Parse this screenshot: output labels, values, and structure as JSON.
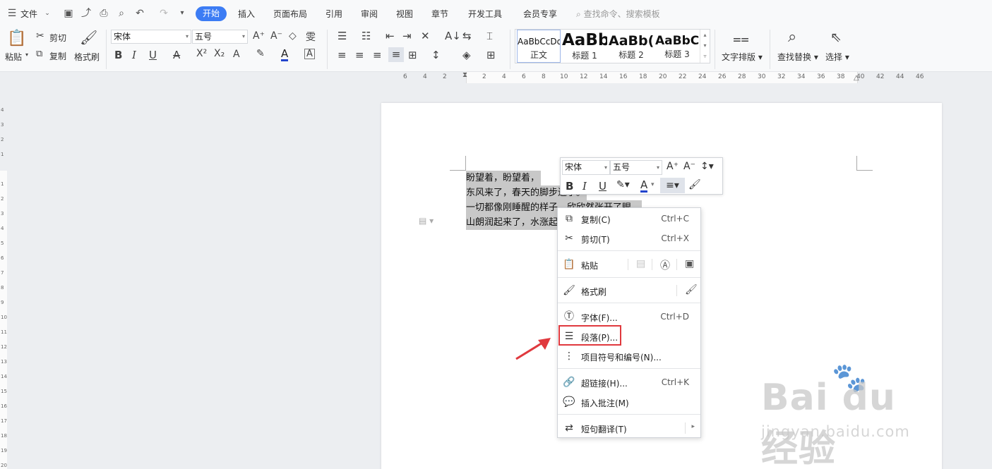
{
  "tabbar": {
    "file": "文件",
    "tabs": [
      "开始",
      "插入",
      "页面布局",
      "引用",
      "审阅",
      "视图",
      "章节",
      "开发工具",
      "会员专享"
    ],
    "search_placeholder": "查找命令、搜索模板"
  },
  "ribbon": {
    "clipboard": {
      "paste": "粘贴",
      "cut": "剪切",
      "copy": "复制",
      "format_painter": "格式刷"
    },
    "font": {
      "name": "宋体",
      "size": "五号"
    },
    "styles": [
      {
        "preview": "AaBbCcDd",
        "name": "正文"
      },
      {
        "preview": "AaBb",
        "name": "标题 1"
      },
      {
        "preview": "AaBb(",
        "name": "标题 2"
      },
      {
        "preview": "AaBbC",
        "name": "标题 3"
      }
    ],
    "text_layout": "文字排版",
    "find_replace": "查找替换",
    "select": "选择"
  },
  "ruler": {
    "left_ticks": [
      "6",
      "4",
      "2",
      "2",
      "4",
      "6",
      "8"
    ],
    "ticks": [
      "10",
      "12",
      "14",
      "16",
      "18",
      "20",
      "22",
      "24",
      "26",
      "28",
      "30",
      "32",
      "34",
      "36",
      "38"
    ],
    "right_ticks": [
      "40",
      "42",
      "44",
      "46"
    ]
  },
  "document": {
    "lines": [
      "盼望着，盼望着，",
      "东风来了，春天的脚步近了。",
      "一切都像刚睡醒的样子，欣欣然张开了眼。",
      "山朗润起来了，水涨起来了"
    ]
  },
  "minibar": {
    "font": "宋体",
    "size": "五号"
  },
  "context_menu": {
    "copy": {
      "label": "复制(C)",
      "shortcut": "Ctrl+C"
    },
    "cut": {
      "label": "剪切(T)",
      "shortcut": "Ctrl+X"
    },
    "paste": {
      "label": "粘贴"
    },
    "format_painter": {
      "label": "格式刷"
    },
    "font": {
      "label": "字体(F)...",
      "shortcut": "Ctrl+D"
    },
    "paragraph": {
      "label": "段落(P)..."
    },
    "bullets": {
      "label": "项目符号和编号(N)..."
    },
    "hyperlink": {
      "label": "超链接(H)...",
      "shortcut": "Ctrl+K"
    },
    "comment": {
      "label": "插入批注(M)"
    },
    "translate": {
      "label": "短句翻译(T)"
    }
  },
  "watermark": {
    "brand": "Bai du 经验",
    "url": "jingyan.baidu.com"
  },
  "colors": {
    "accent": "#3c7cf4",
    "highlight_red": "#e0393e"
  }
}
